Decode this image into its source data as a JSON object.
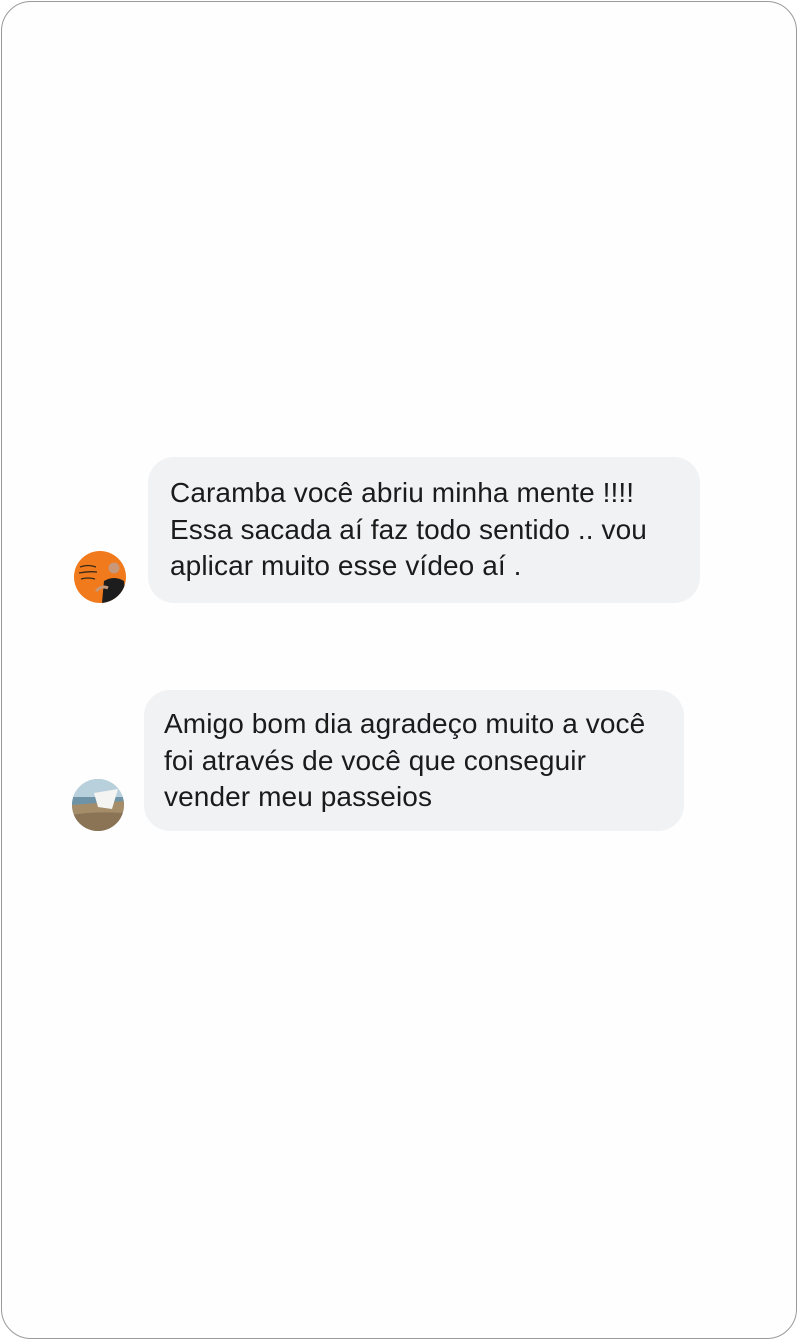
{
  "messages": [
    {
      "avatar": "orange-profile-photo",
      "lines": [
        "Caramba você abriu minha mente !!!!",
        "Essa sacada aí faz todo sentido .. vou",
        "aplicar muito esse vídeo aí ."
      ]
    },
    {
      "avatar": "beach-profile-photo",
      "lines": [
        "Amigo bom dia agradeço muito a você",
        "foi através de você que conseguir",
        "vender meu passeios"
      ]
    }
  ],
  "colors": {
    "bubble_background": "#f1f2f4",
    "text": "#1b1b1b",
    "frame_border": "#9a9a9a"
  }
}
